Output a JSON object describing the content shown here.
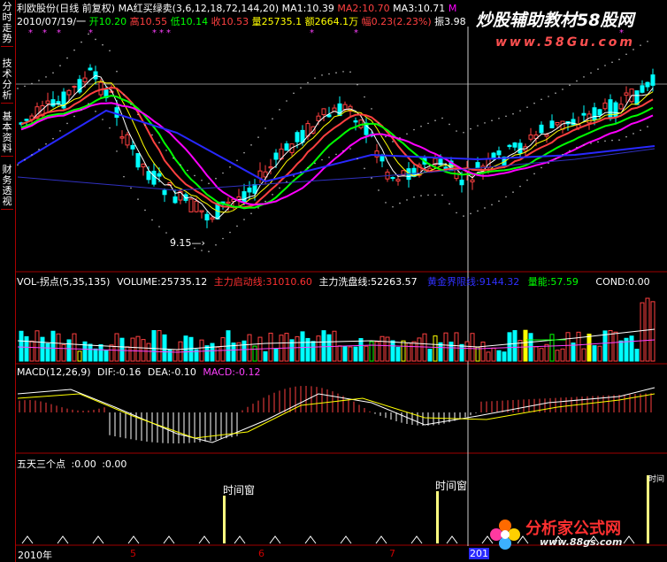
{
  "sidebar": {
    "tabs": [
      {
        "label": "分时走势"
      },
      {
        "label": "技术分析"
      },
      {
        "label": "基本资料"
      },
      {
        "label": "财务透视"
      }
    ]
  },
  "header": {
    "stock_name": "利欧股份(日线 前复权)",
    "ma_label": "MA红买绿卖(3,6,12,18,72,144,20)",
    "ma1": "MA1:10.39",
    "ma2": "MA2:10.70",
    "ma3": "MA3:10.71",
    "ma_more": "M",
    "date": "2010/07/19/一",
    "open": "开10.20",
    "high": "高10.55",
    "low": "低10.14",
    "close": "收10.53",
    "volume": "量25735.1",
    "amount": "额2664.1万",
    "change": "幅0.23(2.23%)",
    "amplitude": "振3.98"
  },
  "price_panel": {
    "low_annotation": "9.15",
    "stars": [
      "*",
      "*",
      "*",
      "*",
      "*",
      "*",
      "*",
      "*",
      "*",
      "*"
    ]
  },
  "volume_panel": {
    "label": "VOL-拐点(5,35,135)",
    "volume": "VOLUME:25735.12",
    "main_start": "主力启动线:31010.60",
    "main_wash": "主力洗盘线:52263.57",
    "mid_line": "黄金界限线:9144.32",
    "energy": "量能:57.59",
    "cond": "COND:0.00"
  },
  "macd_panel": {
    "label": "MACD(12,26,9)",
    "dif": "DIF:-0.16",
    "dea": "DEA:-0.10",
    "macd": "MACD:-0.12"
  },
  "signal_panel": {
    "label": "五天三个点",
    "v1": ":0.00",
    "v2": ":0.00",
    "window1": "时间窗",
    "window2": "时间窗",
    "window3": "时间"
  },
  "x_axis": {
    "labels": [
      "2010年",
      "5",
      "6",
      "7",
      "201"
    ]
  },
  "watermarks": {
    "top": "炒股辅助教材58股网",
    "top_url": "www.58Gu.com",
    "bottom": "分析家公式网",
    "bottom_url": "www.88gs.com"
  },
  "colors": {
    "up": "#ff4040",
    "down": "#00ffff",
    "ma_white": "#ffffff",
    "ma_yellow": "#ffff00",
    "ma_green": "#00ff00",
    "ma_magenta": "#ff00ff",
    "ma_blue": "#2828ff",
    "border": "#a00000"
  }
}
